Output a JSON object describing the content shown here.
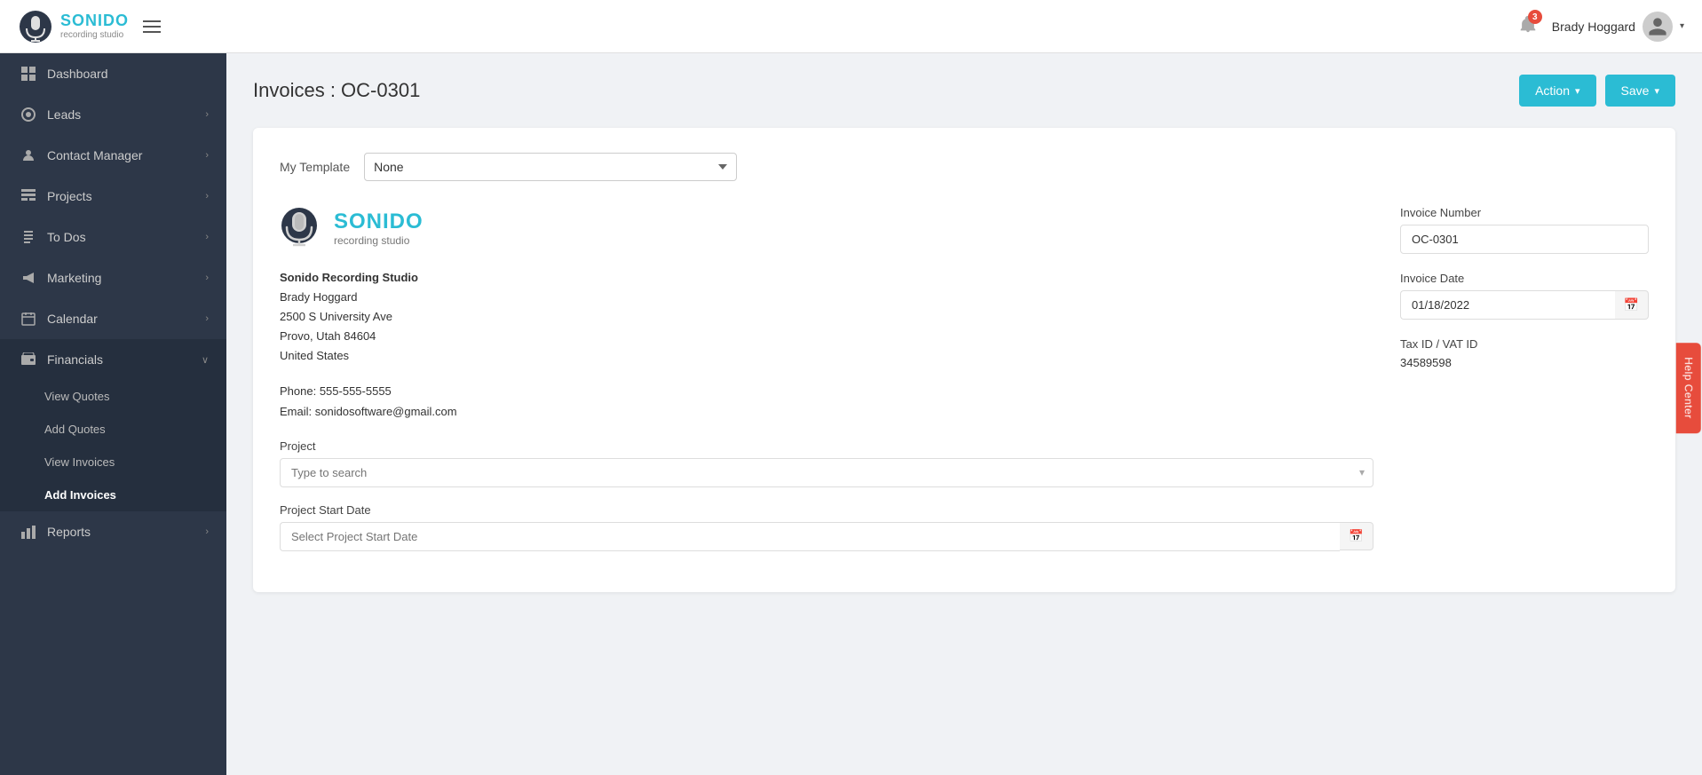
{
  "header": {
    "brand": "SONIDO",
    "brand_sub": "recording studio",
    "hamburger_label": "menu",
    "notification_count": "3",
    "user_name": "Brady Hoggard",
    "chevron": "▾"
  },
  "sidebar": {
    "items": [
      {
        "id": "dashboard",
        "label": "Dashboard",
        "icon": "grid-icon",
        "has_chevron": false
      },
      {
        "id": "leads",
        "label": "Leads",
        "icon": "circle-icon",
        "has_chevron": true
      },
      {
        "id": "contact-manager",
        "label": "Contact Manager",
        "icon": "person-icon",
        "has_chevron": true
      },
      {
        "id": "projects",
        "label": "Projects",
        "icon": "table-icon",
        "has_chevron": true
      },
      {
        "id": "todos",
        "label": "To Dos",
        "icon": "list-icon",
        "has_chevron": true
      },
      {
        "id": "marketing",
        "label": "Marketing",
        "icon": "megaphone-icon",
        "has_chevron": true
      },
      {
        "id": "calendar",
        "label": "Calendar",
        "icon": "calendar-icon",
        "has_chevron": true
      },
      {
        "id": "financials",
        "label": "Financials",
        "icon": "wallet-icon",
        "has_chevron": true,
        "expanded": true
      }
    ],
    "financials_sub": [
      {
        "id": "view-quotes",
        "label": "View Quotes"
      },
      {
        "id": "add-quotes",
        "label": "Add Quotes"
      },
      {
        "id": "view-invoices",
        "label": "View Invoices"
      },
      {
        "id": "add-invoices",
        "label": "Add Invoices",
        "active": true
      }
    ],
    "reports": {
      "label": "Reports",
      "icon": "bar-chart-icon",
      "has_chevron": true
    }
  },
  "main": {
    "page_title": "Invoices : OC-0301",
    "action_btn": "Action",
    "save_btn": "Save",
    "chevron": "▾"
  },
  "invoice": {
    "template_label": "My Template",
    "template_value": "None",
    "template_placeholder": "None",
    "company_name": "Sonido Recording Studio",
    "contact_name": "Brady Hoggard",
    "address1": "2500 S University Ave",
    "address2": "Provo, Utah 84604",
    "country": "United States",
    "phone": "Phone: 555-555-5555",
    "email": "Email: sonidosoftware@gmail.com",
    "project_label": "Project",
    "project_placeholder": "Type to search",
    "project_start_label": "Project Start Date",
    "project_start_placeholder": "Select Project Start Date",
    "invoice_number_label": "Invoice Number",
    "invoice_number_value": "OC-0301",
    "invoice_date_label": "Invoice Date",
    "invoice_date_value": "01/18/2022",
    "tax_label": "Tax ID / VAT ID",
    "tax_value": "34589598"
  },
  "help_center": {
    "label": "Help Center"
  }
}
